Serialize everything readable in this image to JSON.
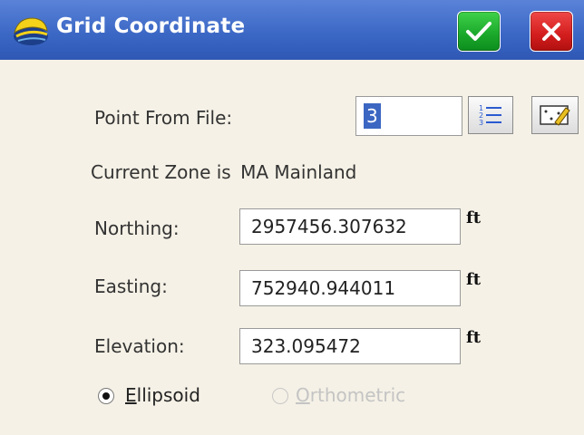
{
  "window": {
    "title": "Grid Coordinate",
    "ok_icon": "checkmark-icon",
    "cancel_icon": "close-icon"
  },
  "point_from_file": {
    "label": "Point From File:",
    "value": "3",
    "list_icon": "numbered-list-icon",
    "map_icon": "map-pick-icon"
  },
  "zone": {
    "prefix": "Current Zone is",
    "name": "MA Mainland"
  },
  "northing": {
    "label": "Northing:",
    "value": "2957456.307632",
    "unit": "ft"
  },
  "easting": {
    "label": "Easting:",
    "value": "752940.944011",
    "unit": "ft"
  },
  "elevation": {
    "label": "Elevation:",
    "value": "323.095472",
    "unit": "ft"
  },
  "elevation_type": {
    "options": [
      {
        "label_first": "E",
        "label_rest": "llipsoid",
        "selected": true,
        "enabled": true
      },
      {
        "label_first": "O",
        "label_rest": "rthometric",
        "selected": false,
        "enabled": false
      }
    ]
  },
  "colors": {
    "titlebar": "#3a66c4",
    "ok": "#1aa72a",
    "cancel": "#d31d1d",
    "background": "#f5f1e6",
    "selection": "#3b66c2"
  }
}
